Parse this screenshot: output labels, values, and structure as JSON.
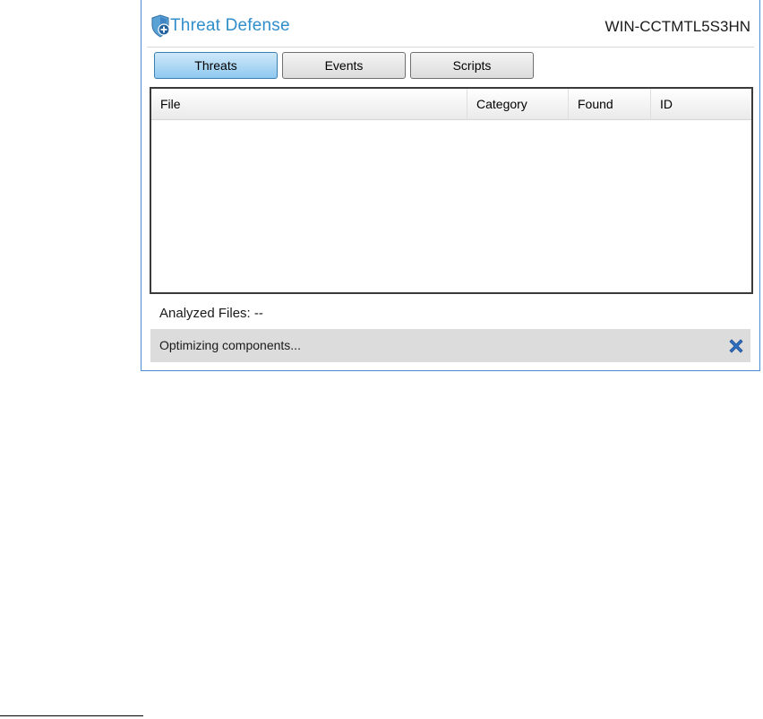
{
  "app": {
    "title": "Threat Defense",
    "hostname": "WIN-CCTMTL5S3HN",
    "accent_color": "#2f8ecb"
  },
  "tabs": [
    {
      "label": "Threats",
      "active": true
    },
    {
      "label": "Events",
      "active": false
    },
    {
      "label": "Scripts",
      "active": false
    }
  ],
  "table": {
    "columns": [
      "File",
      "Category",
      "Found",
      "ID"
    ],
    "rows": []
  },
  "analyzed": {
    "label": "Analyzed Files: --"
  },
  "status": {
    "text": "Optimizing components...",
    "close_icon": "close-x-icon",
    "close_color": "#2f6fc1"
  },
  "icons": {
    "app_icon": "shield-plus-icon"
  }
}
